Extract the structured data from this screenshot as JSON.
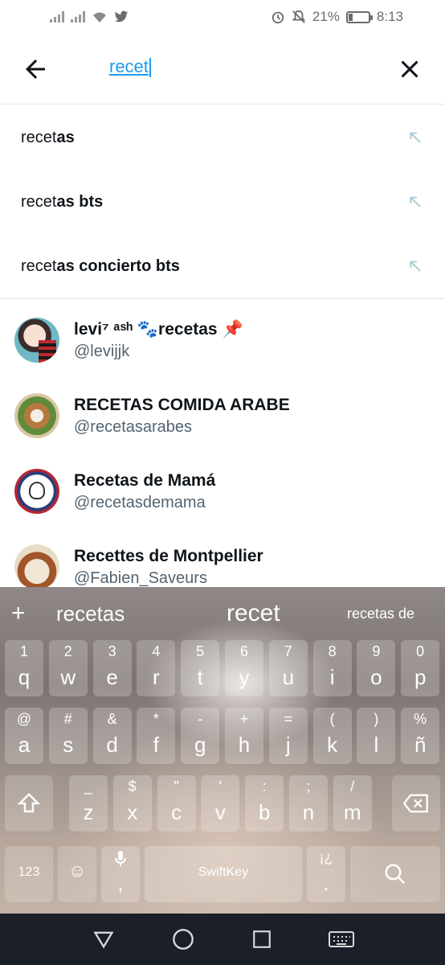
{
  "status_bar": {
    "battery_text": "21%",
    "battery_level": 0.21,
    "time": "8:13"
  },
  "search": {
    "query": "recet"
  },
  "suggestions": [
    {
      "typed": "recet",
      "completion": "as"
    },
    {
      "typed": "recet",
      "completion": "as bts"
    },
    {
      "typed": "recet",
      "completion": "as concierto bts"
    }
  ],
  "users": [
    {
      "name": "levi⁷ ᵃˢʰ 🐾recetas 📌",
      "handle": "@levijjk"
    },
    {
      "name": "RECETAS COMIDA ARABE",
      "handle": "@recetasarabes"
    },
    {
      "name": "Recetas de Mamá",
      "handle": "@recetasdemama"
    },
    {
      "name": "Recettes de Montpellier",
      "handle": "@Fabien_Saveurs"
    }
  ],
  "keyboard": {
    "suggestions": [
      "recetas",
      "recet",
      "recetas de"
    ],
    "row1": [
      {
        "alt": "1",
        "main": "q"
      },
      {
        "alt": "2",
        "main": "w"
      },
      {
        "alt": "3",
        "main": "e"
      },
      {
        "alt": "4",
        "main": "r"
      },
      {
        "alt": "5",
        "main": "t"
      },
      {
        "alt": "6",
        "main": "y"
      },
      {
        "alt": "7",
        "main": "u"
      },
      {
        "alt": "8",
        "main": "i"
      },
      {
        "alt": "9",
        "main": "o"
      },
      {
        "alt": "0",
        "main": "p"
      }
    ],
    "row2": [
      {
        "alt": "@",
        "main": "a"
      },
      {
        "alt": "#",
        "main": "s"
      },
      {
        "alt": "&",
        "main": "d"
      },
      {
        "alt": "*",
        "main": "f"
      },
      {
        "alt": "-",
        "main": "g"
      },
      {
        "alt": "+",
        "main": "h"
      },
      {
        "alt": "=",
        "main": "j"
      },
      {
        "alt": "(",
        "main": "k"
      },
      {
        "alt": ")",
        "main": "l"
      },
      {
        "alt": "%",
        "main": "ñ"
      }
    ],
    "row3": [
      {
        "alt": "_",
        "main": "z"
      },
      {
        "alt": "$",
        "main": "x"
      },
      {
        "alt": "\"",
        "main": "c"
      },
      {
        "alt": "'",
        "main": "v"
      },
      {
        "alt": ":",
        "main": "b"
      },
      {
        "alt": ";",
        "main": "n"
      },
      {
        "alt": "/",
        "main": "m"
      }
    ],
    "numbers_key": "123",
    "comma": ",",
    "space_logo": "SwiftKey",
    "period_alt": "¡¿",
    "period": "."
  }
}
